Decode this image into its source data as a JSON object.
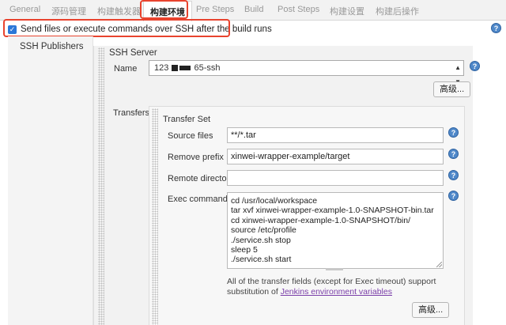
{
  "tabs": [
    {
      "label": "General"
    },
    {
      "label": "源码管理"
    },
    {
      "label": "构建触发器"
    },
    {
      "label": "构建环境"
    },
    {
      "label": "Pre Steps"
    },
    {
      "label": "Build"
    },
    {
      "label": "Post Steps"
    },
    {
      "label": "构建设置"
    },
    {
      "label": "构建后操作"
    }
  ],
  "active_tab": "构建环境",
  "checkbox": {
    "label": "Send files or execute commands over SSH after the build runs",
    "checked": true
  },
  "help_glyph": "?",
  "publishers": {
    "label": "SSH Publishers"
  },
  "ssh_server": {
    "title": "SSH Server",
    "name_label": "Name",
    "name_value_prefix": "123",
    "name_value_suffix": "65-ssh",
    "advanced_label": "高级..."
  },
  "transfers": {
    "label": "Transfers",
    "set_title": "Transfer Set",
    "source_files_label": "Source files",
    "source_files_value": "**/*.tar",
    "remove_prefix_label": "Remove prefix",
    "remove_prefix_value": "xinwei-wrapper-example/target",
    "remote_directory_label": "Remote directory",
    "remote_directory_value": "",
    "exec_command_label": "Exec command",
    "exec_command_lines": [
      "cd /usr/local/workspace",
      "tar xvf xinwei-wrapper-example-1.0-SNAPSHOT-bin.tar",
      "cd xinwei-wrapper-example-1.0-SNAPSHOT/bin/",
      "source /etc/profile",
      "./service.sh stop",
      "sleep 5",
      "./service.sh start"
    ],
    "note_text": "All of the transfer fields (except for Exec timeout) support substitution of",
    "note_link": "Jenkins environment variables",
    "advanced_label": "高级..."
  },
  "colors": {
    "highlight": "#e8432e",
    "help": "#4f88c9",
    "link": "#7a3ea8",
    "checkbox": "#2b77d8"
  },
  "icons": [
    "help-icon",
    "checkbox-checked-icon",
    "dropdown-arrow-icon",
    "resize-handle-icon",
    "drag-handle-icon"
  ]
}
